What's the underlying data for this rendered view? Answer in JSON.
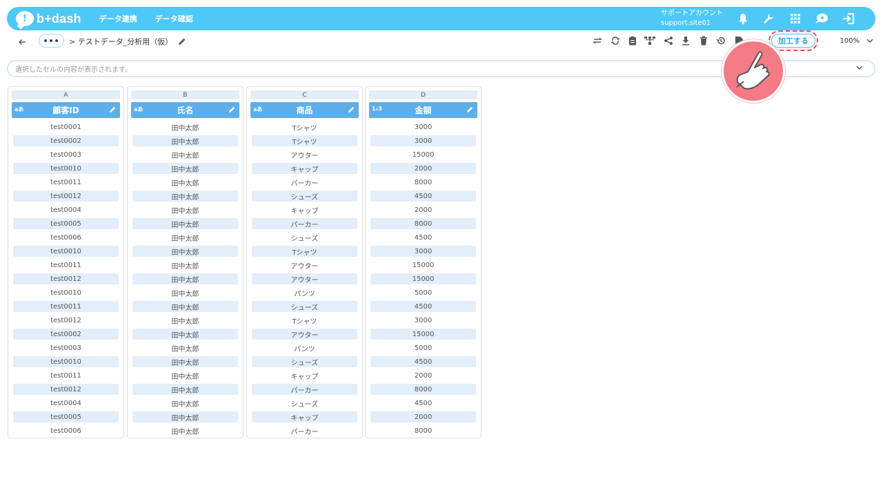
{
  "app": {
    "logo_text": "b+dash",
    "logo_mark": "!",
    "nav": [
      "データ連携",
      "データ確認"
    ],
    "account_name": "サポートアカウント",
    "account_site": "support.site01",
    "icons": [
      "bell-icon",
      "wrench-icon",
      "grid-apps-icon",
      "chat-icon",
      "logout-icon"
    ]
  },
  "toolbar": {
    "more_label": "•••",
    "breadcrumb": "> テストデータ_分析用（仮）",
    "icons": [
      "swap-icon",
      "refresh-icon",
      "clipboard-icon",
      "flow-icon",
      "share-icon",
      "download-icon",
      "delete-icon",
      "history-icon",
      "report-icon"
    ],
    "process_label": "加工する",
    "zoom_label": "100%"
  },
  "cellbar": {
    "placeholder": "選択したセルの内容が表示されます。"
  },
  "columns": [
    {
      "letter": "A",
      "type_label": "aあ",
      "name": "顧客ID",
      "cells": [
        "test0001",
        "test0002",
        "test0003",
        "test0010",
        "test0011",
        "test0012",
        "test0004",
        "test0005",
        "test0006",
        "test0010",
        "test0011",
        "test0012",
        "test0010",
        "test0011",
        "test0012",
        "test0002",
        "test0003",
        "test0010",
        "test0011",
        "test0012",
        "test0004",
        "test0005",
        "test0006"
      ]
    },
    {
      "letter": "B",
      "type_label": "aあ",
      "name": "氏名",
      "cells": [
        "田中太郎",
        "田中太郎",
        "田中太郎",
        "田中太郎",
        "田中太郎",
        "田中太郎",
        "田中太郎",
        "田中太郎",
        "田中太郎",
        "田中太郎",
        "田中太郎",
        "田中太郎",
        "田中太郎",
        "田中太郎",
        "田中太郎",
        "田中太郎",
        "田中太郎",
        "田中太郎",
        "田中太郎",
        "田中太郎",
        "田中太郎",
        "田中太郎",
        "田中太郎"
      ]
    },
    {
      "letter": "C",
      "type_label": "aあ",
      "name": "商品",
      "cells": [
        "Tシャツ",
        "Tシャツ",
        "アウター",
        "キャップ",
        "パーカー",
        "シューズ",
        "キャップ",
        "パーカー",
        "シューズ",
        "Tシャツ",
        "アウター",
        "アウター",
        "パンツ",
        "シューズ",
        "Tシャツ",
        "アウター",
        "パンツ",
        "シューズ",
        "キャップ",
        "パーカー",
        "シューズ",
        "キャップ",
        "パーカー"
      ]
    },
    {
      "letter": "D",
      "type_label": "1₂3",
      "name": "金額",
      "cells": [
        "3000",
        "3000",
        "15000",
        "2000",
        "8000",
        "4500",
        "2000",
        "8000",
        "4500",
        "3000",
        "15000",
        "15000",
        "5000",
        "4500",
        "3000",
        "15000",
        "5000",
        "4500",
        "2000",
        "8000",
        "4500",
        "2000",
        "8000"
      ]
    }
  ],
  "colors": {
    "topbar": "#4ec8f7",
    "column_header": "#5eaee9",
    "stripe": "#e2eef9",
    "highlight": "#e8506a"
  }
}
